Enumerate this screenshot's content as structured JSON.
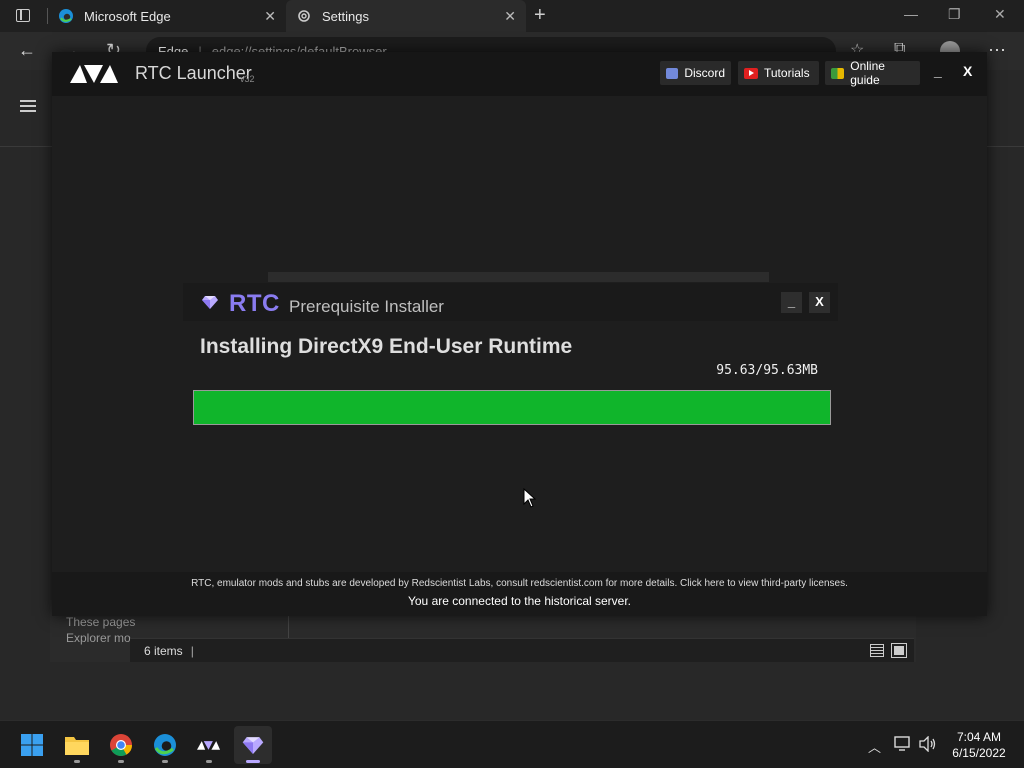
{
  "edge": {
    "tabs": [
      {
        "title": "Microsoft Edge",
        "close": "✕"
      },
      {
        "title": "Settings",
        "close": "✕"
      }
    ],
    "new_tab": "+",
    "address_label": "Edge",
    "address_url": "edge://settings/defaultBrowser"
  },
  "explorer": {
    "left_text_1": "These pages",
    "left_text_2": "Explorer mo",
    "status_items": "6 items",
    "status_cursor": "|"
  },
  "launcher": {
    "title": "RTC Launcher",
    "version": "v32",
    "links": {
      "discord": "Discord",
      "tutorials": "Tutorials",
      "guide": "Online guide"
    },
    "minimize": "_",
    "close": "X",
    "footer_note": "RTC, emulator mods and stubs are developed by Redscientist Labs, consult redscientist.com for more details. Click here to view third-party licenses.",
    "footer_server": "You are connected to the historical server."
  },
  "installer": {
    "brand": "RTC",
    "subtitle": "Prerequisite Installer",
    "minimize": "_",
    "close": "X",
    "status": "Installing DirectX9 End-User Runtime",
    "size": "95.63/95.63MB",
    "progress": 1.0,
    "progress_color": "#10b52b",
    "accent_color": "#8a7cf0"
  },
  "taskbar": {
    "apps": [
      "start-icon",
      "file-explorer-icon",
      "chrome-icon",
      "edge-icon",
      "rtc-launcher-icon",
      "rtc-installer-icon"
    ],
    "time": "7:04 AM",
    "date": "6/15/2022"
  }
}
